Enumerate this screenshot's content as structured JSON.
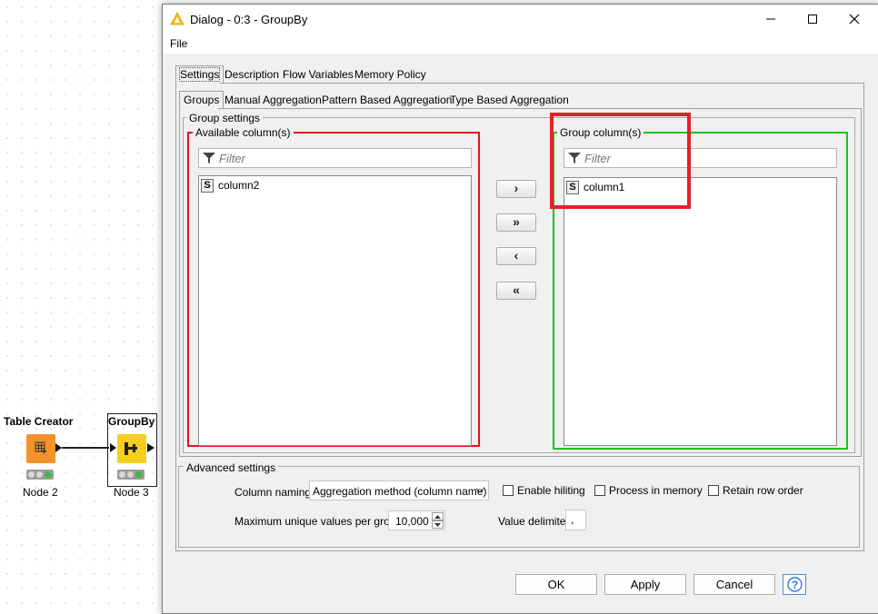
{
  "workflow": {
    "node_creator": {
      "title": "Table Creator",
      "label": "Node 2"
    },
    "node_groupby": {
      "title": "GroupBy",
      "label": "Node 3"
    }
  },
  "dialog": {
    "title": "Dialog - 0:3 - GroupBy",
    "menu": {
      "file": "File"
    },
    "tabs": [
      "Settings",
      "Description",
      "Flow Variables",
      "Memory Policy"
    ],
    "subtabs": [
      "Groups",
      "Manual Aggregation",
      "Pattern Based Aggregation",
      "Type Based Aggregation"
    ],
    "group_settings": {
      "legend": "Group settings",
      "available": {
        "legend": "Available column(s)",
        "filter_placeholder": "Filter",
        "items": [
          {
            "type": "S",
            "name": "column2"
          }
        ]
      },
      "group": {
        "legend": "Group column(s)",
        "filter_placeholder": "Filter",
        "items": [
          {
            "type": "S",
            "name": "column1"
          }
        ]
      },
      "buttons": {
        "add": "›",
        "add_all": "»",
        "remove": "‹",
        "remove_all": "«"
      }
    },
    "advanced": {
      "legend": "Advanced settings",
      "column_naming_label": "Column naming:",
      "column_naming_value": "Aggregation method (column name)",
      "enable_hiliting": "Enable hiliting",
      "process_in_memory": "Process in memory",
      "retain_row_order": "Retain row order",
      "max_unique_label": "Maximum unique values per group",
      "max_unique_value": "10,000",
      "value_delimiter_label": "Value delimiter",
      "value_delimiter_value": ","
    },
    "footer": {
      "ok": "OK",
      "apply": "Apply",
      "cancel": "Cancel",
      "help": "?"
    }
  },
  "colors": {
    "available_border": "#e0141c",
    "group_border": "#1ec21e",
    "highlight_box": "#e32128",
    "creator_node": "#f3922b",
    "groupby_node": "#f4cf1d"
  }
}
